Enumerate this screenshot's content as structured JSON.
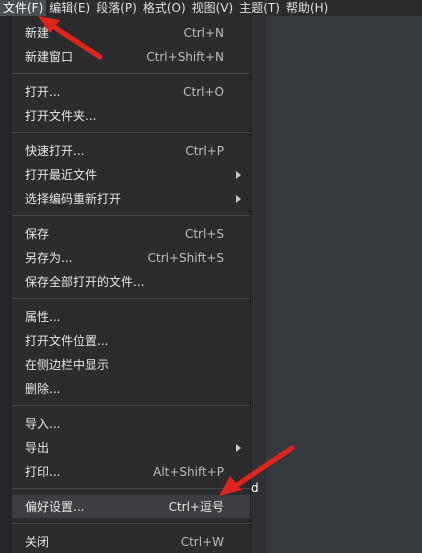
{
  "menubar": {
    "items": [
      {
        "label": "文件(F)",
        "active": true
      },
      {
        "label": "编辑(E)"
      },
      {
        "label": "段落(P)"
      },
      {
        "label": "格式(O)"
      },
      {
        "label": "视图(V)"
      },
      {
        "label": "主题(T)"
      },
      {
        "label": "帮助(H)"
      }
    ]
  },
  "file_menu": {
    "items": [
      {
        "label": "新建",
        "shortcut": "Ctrl+N"
      },
      {
        "label": "新建窗口",
        "shortcut": "Ctrl+Shift+N"
      },
      {
        "label": "打开...",
        "shortcut": "Ctrl+O"
      },
      {
        "label": "打开文件夹...",
        "shortcut": ""
      },
      {
        "label": "快速打开...",
        "shortcut": "Ctrl+P"
      },
      {
        "label": "打开最近文件",
        "shortcut": "",
        "submenu": true
      },
      {
        "label": "选择编码重新打开",
        "shortcut": "",
        "submenu": true
      },
      {
        "label": "保存",
        "shortcut": "Ctrl+S"
      },
      {
        "label": "另存为...",
        "shortcut": "Ctrl+Shift+S"
      },
      {
        "label": "保存全部打开的文件...",
        "shortcut": ""
      },
      {
        "label": "属性...",
        "shortcut": ""
      },
      {
        "label": "打开文件位置...",
        "shortcut": ""
      },
      {
        "label": "在侧边栏中显示",
        "shortcut": ""
      },
      {
        "label": "删除...",
        "shortcut": ""
      },
      {
        "label": "导入...",
        "shortcut": ""
      },
      {
        "label": "导出",
        "shortcut": "",
        "submenu": true
      },
      {
        "label": "打印...",
        "shortcut": "Alt+Shift+P"
      },
      {
        "label": "偏好设置...",
        "shortcut": "Ctrl+逗号",
        "highlighted": true
      },
      {
        "label": "关闭",
        "shortcut": "Ctrl+W"
      }
    ]
  },
  "editor": {
    "fragment_text": "d"
  },
  "colors": {
    "menubar_bg": "#2b2c2e",
    "menu_bg": "#2b2c2e",
    "highlight_bg": "#3c3e42",
    "editor_bg": "#36393d",
    "annotation_arrow": "#e0241b"
  }
}
